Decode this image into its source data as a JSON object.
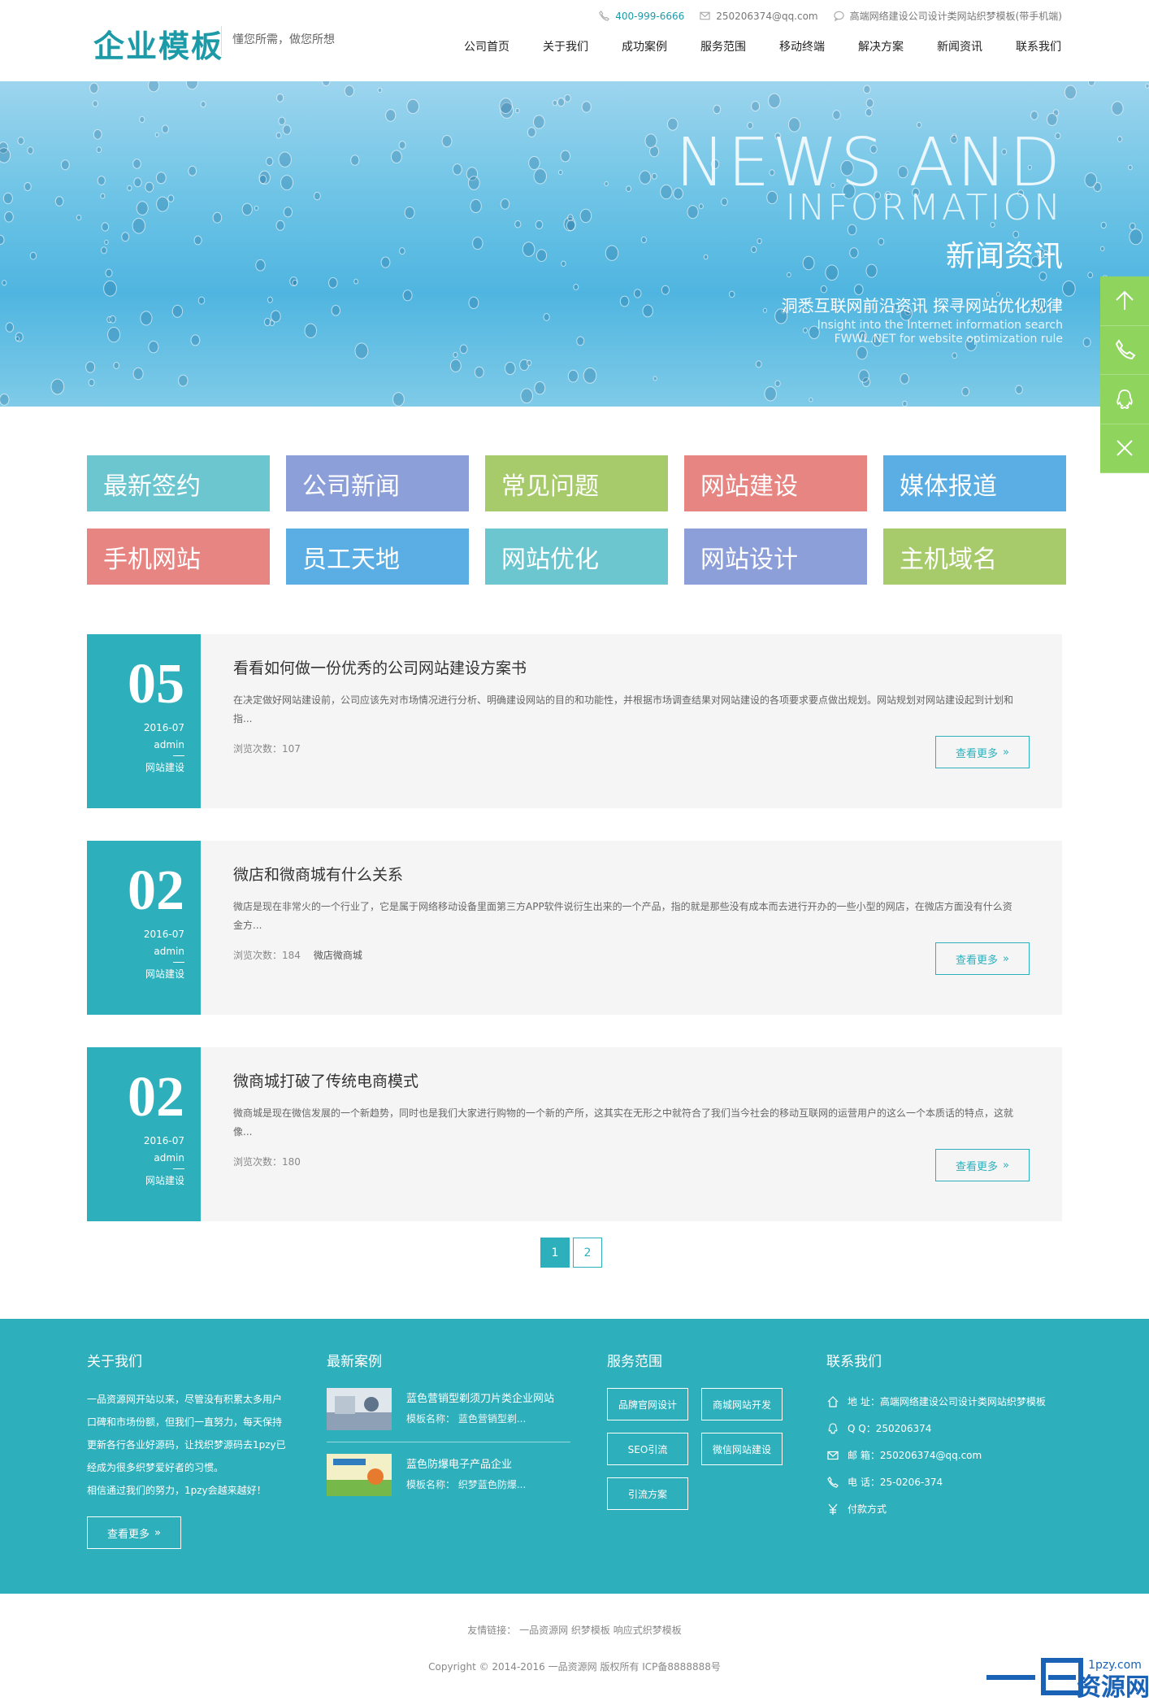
{
  "header": {
    "logo": "企业模板",
    "slogan": "懂您所需，做您所想",
    "phone": "400-999-6666",
    "email": "250206374@qq.com",
    "topnote": "高端网络建设公司设计类网站织梦模板(带手机端)",
    "nav": [
      "公司首页",
      "关于我们",
      "成功案例",
      "服务范围",
      "移动终端",
      "解决方案",
      "新闻资讯",
      "联系我们"
    ]
  },
  "banner": {
    "line1": "NEWS AND",
    "line2": "INFORMATION",
    "line3": "新闻资讯",
    "line4": "洞悉互联网前沿资讯  探寻网站优化规律",
    "line5a": "Insight into the Internet information search",
    "line5b": "FWWL.NET for website optimization rule"
  },
  "categories": [
    {
      "label": "最新签约",
      "color": "#6cc6d0"
    },
    {
      "label": "公司新闻",
      "color": "#8c9fd9"
    },
    {
      "label": "常见问题",
      "color": "#a7cb6a"
    },
    {
      "label": "网站建设",
      "color": "#e68582"
    },
    {
      "label": "媒体报道",
      "color": "#5baee3"
    },
    {
      "label": "手机网站",
      "color": "#e68582"
    },
    {
      "label": "员工天地",
      "color": "#5baee3"
    },
    {
      "label": "网站优化",
      "color": "#6cc6d0"
    },
    {
      "label": "网站设计",
      "color": "#8c9fd9"
    },
    {
      "label": "主机域名",
      "color": "#a7cb6a"
    }
  ],
  "news": [
    {
      "day": "05",
      "ym": "2016-07",
      "author": "admin",
      "cat": "网站建设",
      "title": "看看如何做一份优秀的公司网站建设方案书",
      "desc": "在决定做好网站建设前，公司应该先对市场情况进行分析、明确建设网站的目的和功能性，并根据市场调查结果对网站建设的各项要求要点做出规划。网站规划对网站建设起到计划和指...",
      "views": "浏览次数：107",
      "tag": "",
      "more": "查看更多"
    },
    {
      "day": "02",
      "ym": "2016-07",
      "author": "admin",
      "cat": "网站建设",
      "title": "微店和微商城有什么关系",
      "desc": "微店是现在非常火的一个行业了，它是属于网络移动设备里面第三方APP软件说衍生出来的一个产品，指的就是那些没有成本而去进行开办的一些小型的网店，在微店方面没有什么资金方...",
      "views": "浏览次数：184",
      "tag": "微店微商城",
      "more": "查看更多"
    },
    {
      "day": "02",
      "ym": "2016-07",
      "author": "admin",
      "cat": "网站建设",
      "title": "微商城打破了传统电商模式",
      "desc": "微商城是现在微信发展的一个新趋势，同时也是我们大家进行购物的一个新的产所，这其实在无形之中就符合了我们当今社会的移动互联网的运营用户的这么一个本质话的特点，这就像...",
      "views": "浏览次数：180",
      "tag": "",
      "more": "查看更多"
    }
  ],
  "pager": [
    "1",
    "2"
  ],
  "footer": {
    "about_title": "关于我们",
    "about_text": "一品资源网开站以来，尽管没有积累太多用户口碑和市场份额，但我们一直努力，每天保持更新各行各业好源码，让找织梦源码去1pzy已经成为很多织梦爱好者的习惯。",
    "about_text2": "相信通过我们的努力，1pzy会越来越好！",
    "about_more": "查看更多",
    "case_title": "最新案例",
    "cases": [
      {
        "title": "蓝色营销型剃须刀片类企业网站",
        "sub": "模板名称：  蓝色营销型剃..."
      },
      {
        "title": "蓝色防爆电子产品企业",
        "sub": "模板名称：  织梦蓝色防爆..."
      }
    ],
    "svc_title": "服务范围",
    "services": [
      "品牌官网设计",
      "商城网站开发",
      "SEO引流",
      "微信网站建设",
      "引流方案"
    ],
    "contact_title": "联系我们",
    "contacts": [
      {
        "icon": "home-icon",
        "text": "地 址：高端网络建设公司设计类网站织梦模板"
      },
      {
        "icon": "qq-icon",
        "text": "Q Q：250206374"
      },
      {
        "icon": "mail-icon",
        "text": "邮 箱：250206374@qq.com"
      },
      {
        "icon": "phone-icon",
        "text": "电 话：25-0206-374"
      },
      {
        "icon": "yen-icon",
        "text": "付款方式"
      }
    ],
    "links": "友情链接：  一品资源网  织梦模板  响应式织梦模板",
    "copyright": "Copyright © 2014-2016 一品资源网 版权所有 ICP备8888888号"
  },
  "watermark": {
    "top": "1pzy.com",
    "main": "一品资源网"
  },
  "colors": {
    "accent": "#2eb0bc",
    "side": "#8fd45c"
  }
}
